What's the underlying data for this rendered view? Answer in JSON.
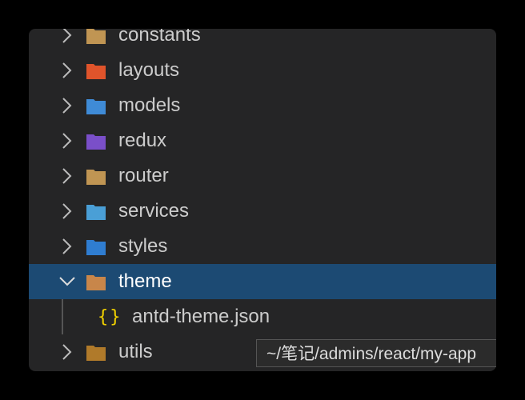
{
  "explorer": {
    "items": [
      {
        "label": "constants",
        "icon": "folder-icon",
        "color": "#c09553",
        "expanded": false
      },
      {
        "label": "layouts",
        "icon": "folder-layout-icon",
        "color": "#e0542b",
        "expanded": false
      },
      {
        "label": "models",
        "icon": "folder-models-icon",
        "color": "#3f8bd6",
        "expanded": false
      },
      {
        "label": "redux",
        "icon": "folder-redux-icon",
        "color": "#7a4fc9",
        "expanded": false
      },
      {
        "label": "router",
        "icon": "folder-icon",
        "color": "#c09553",
        "expanded": false
      },
      {
        "label": "services",
        "icon": "folder-services-icon",
        "color": "#4a9fd6",
        "expanded": false
      },
      {
        "label": "styles",
        "icon": "folder-styles-icon",
        "color": "#2f7dd1",
        "expanded": false
      },
      {
        "label": "theme",
        "icon": "folder-theme-icon",
        "color": "#c8864a",
        "expanded": true,
        "selected": true
      },
      {
        "label": "antd-theme.json",
        "icon": "json-braces-icon",
        "color": "#f0d000",
        "child": true
      },
      {
        "label": "utils",
        "icon": "folder-utils-icon",
        "color": "#b07a2a",
        "expanded": false
      }
    ]
  },
  "tooltip": {
    "text": "~/笔记/admins/react/my-app"
  }
}
